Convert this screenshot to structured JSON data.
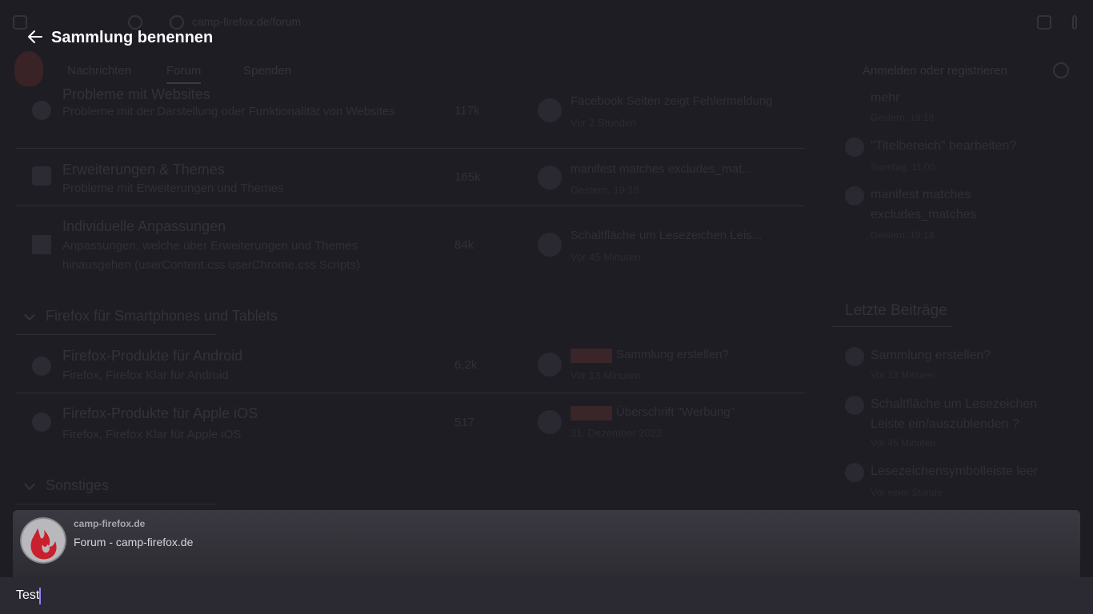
{
  "header": {
    "title": "Sammlung benennen"
  },
  "card": {
    "site": "camp-firefox.de",
    "page": "Forum - camp-firefox.de"
  },
  "input": {
    "value": "Test"
  },
  "background_page": {
    "url": "camp-firefox.de/forum",
    "nav": [
      "Nachrichten",
      "Forum",
      "Spenden"
    ],
    "login": "Anmelden oder registrieren",
    "rows": [
      {
        "title": "Probleme mit Websites",
        "desc": "Probleme mit der Darstellung oder Funktionalität von Websites",
        "count": "117k",
        "last_title": "Facebook Seiten zeigt Fehlermeldung",
        "last_meta": "Vor 2 Stunden"
      },
      {
        "title": "Erweiterungen & Themes",
        "desc": "Probleme mit Erweiterungen und Themes",
        "count": "165k",
        "last_title": "manifest matches excludes_mat...",
        "last_meta": "Gestern, 19:18"
      },
      {
        "title": "Individuelle Anpassungen",
        "desc": "Anpassungen, welche über Erweiterungen und Themes hinausgehen (userContent.css userChrome.css Scripts)",
        "count": "84k",
        "last_title": "Schaltfläche um Lesezeichen Leis...",
        "last_meta": "Vor 45 Minuten"
      }
    ],
    "section_mobile": "Firefox für Smartphones und Tablets",
    "mobile_rows": [
      {
        "title": "Firefox-Produkte für Android",
        "desc": "Firefox, Firefox Klar für Android",
        "count": "6,2k",
        "last_title": "Sammlung erstellen?",
        "last_meta": "Vor 13 Minuten"
      },
      {
        "title": "Firefox-Produkte für Apple iOS",
        "desc": "Firefox, Firefox Klar für Apple iOS",
        "count": "517",
        "last_title": "Überschrift \"Werbung\"",
        "last_meta": "31. Dezember 2022"
      }
    ],
    "section_other": "Sonstiges",
    "sidebar_top": [
      {
        "title": "mehr",
        "meta": "Gestern, 19:18"
      },
      {
        "title": "\"Titelbereich\" bearbeiten?",
        "meta": "Sonntag, 11:00"
      },
      {
        "title": "manifest matches excludes_matches",
        "meta": "Gestern, 19:18"
      }
    ],
    "sidebar_heading": "Letzte Beiträge",
    "sidebar_recent": [
      {
        "title": "Sammlung erstellen?",
        "meta": "Vor 13 Minuten"
      },
      {
        "title": "Schaltfläche um Lesezeichen Leiste ein/auszublenden ?",
        "meta": "Vor 45 Minuten"
      },
      {
        "title": "Lesezeichensymbolleiste leer",
        "meta": "Vor einer Stunde"
      }
    ]
  },
  "colors": {
    "accent": "#9b7bff",
    "overlay_bg": "#1c1b22",
    "card_bg": "#3a3941",
    "input_bg": "#2b2a33"
  }
}
